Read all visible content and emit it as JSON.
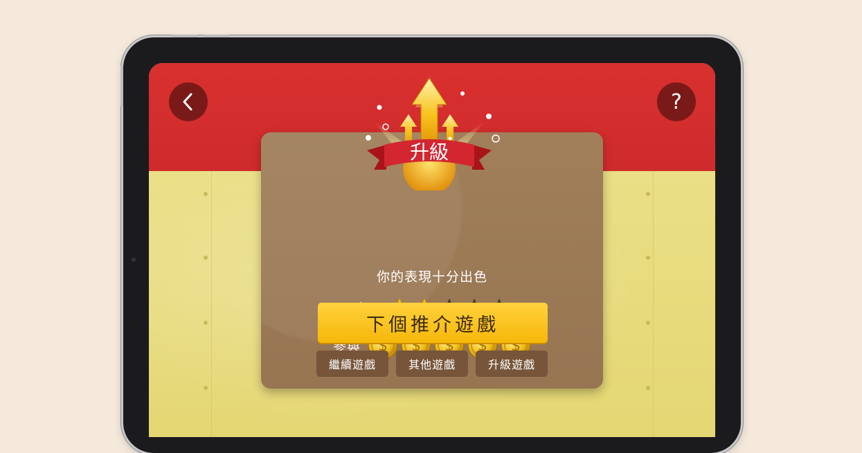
{
  "header": {
    "back_icon": "chevron-left-icon",
    "help_label": "?"
  },
  "emblem": {
    "badge_text": "升級",
    "icon": "upward-arrows-icon"
  },
  "result": {
    "message": "你的表現十分出色",
    "performance_label": "表現",
    "performance_stars": 2,
    "performance_max": 5,
    "participation_label": "參與",
    "participation_coins": 5,
    "coin_symbol": "$"
  },
  "actions": {
    "primary_label": "下個推介遊戲",
    "continue_label": "繼續遊戲",
    "other_label": "其他遊戲",
    "upgrade_label": "升級遊戲"
  },
  "colors": {
    "red_band": "#d8302f",
    "yellow_bg": "#e6d978",
    "panel": "#9c7b56",
    "cta": "#f8c11c",
    "star_on": "#f5b400",
    "star_off": "#4a3a2c"
  }
}
